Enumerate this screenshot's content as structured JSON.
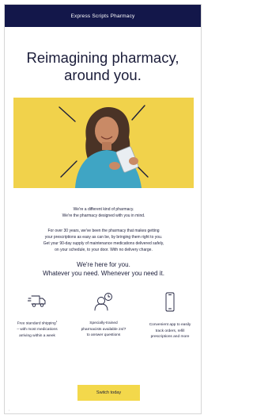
{
  "header": {
    "brand": "Express Scripts Pharmacy"
  },
  "headline": {
    "line1": "Reimagining pharmacy,",
    "line2": "around you."
  },
  "intro": {
    "line1": "We're a different kind of pharmacy.",
    "line2": "We're the pharmacy designed with you in mind."
  },
  "body_copy": {
    "line1": "For over 30 years, we've been the pharmacy that makes getting",
    "line2": "your prescriptions as easy as can be, by bringing them right to you.",
    "line3": "Get your 90-day supply of maintenance medications delivered safely,",
    "line4": "on your schedule, to your door. With no delivery charge."
  },
  "tagline": {
    "line1": "We're here for you.",
    "line2": "Whatever you need. Whenever you need it."
  },
  "features": [
    {
      "icon": "delivery-truck-icon",
      "line1": "Free standard shipping",
      "line2": "– with most medications",
      "line3": "arriving within a week"
    },
    {
      "icon": "pharmacist-clock-icon",
      "line1": "Specially-trained",
      "line2": "pharmacists available 24/7",
      "line3": "to answer questions"
    },
    {
      "icon": "smartphone-icon",
      "line1": "Convenient app to easily",
      "line2": "track orders, refill",
      "line3": "prescriptions and more"
    }
  ],
  "cta": {
    "label": "Switch today"
  },
  "colors": {
    "navy": "#13174a",
    "yellow": "#f1d24b",
    "text": "#1b1d3a"
  }
}
